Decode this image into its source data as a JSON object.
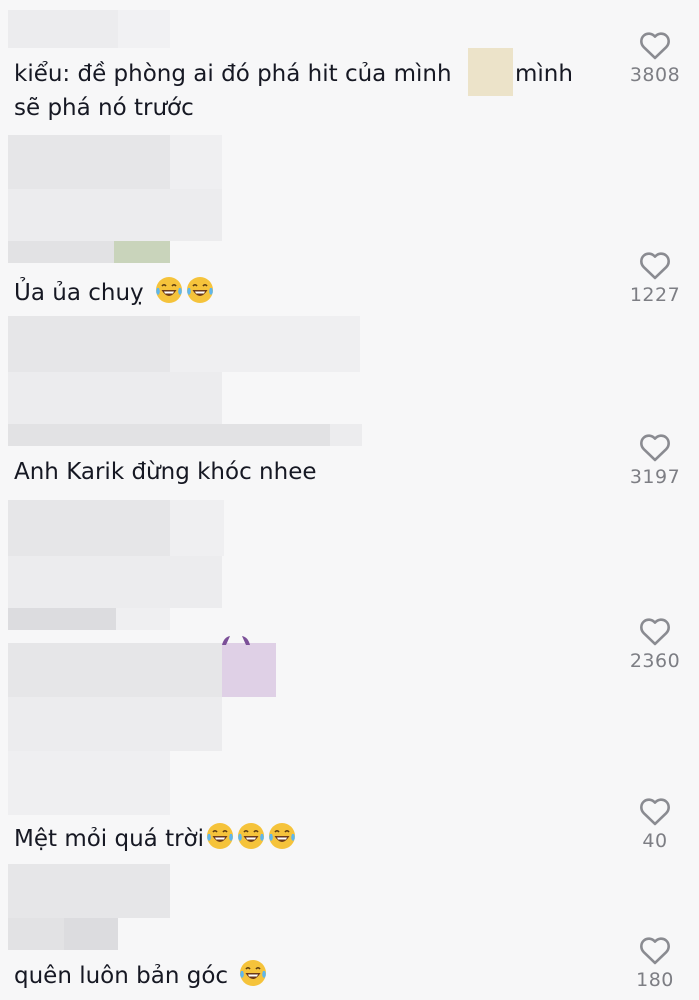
{
  "comments": [
    {
      "text_line1_a": "kiểu: đề phòng ai đó phá hit của mình",
      "text_line1_b": "mình",
      "text_line2": "sẽ phá nó trước",
      "likes": "3808",
      "emoji": []
    },
    {
      "text": "Ủa ủa chuỵ",
      "likes": "1227",
      "emoji": [
        "laughing-tears-emoji",
        "laughing-tears-emoji"
      ]
    },
    {
      "text": "Anh Karik đừng khóc nhee",
      "likes": "3197",
      "emoji": []
    },
    {
      "likes": "2360"
    },
    {
      "text": "Mệt mỏi quá trời",
      "likes": "40",
      "emoji": [
        "laughing-tears-emoji",
        "laughing-tears-emoji",
        "laughing-tears-emoji"
      ]
    },
    {
      "text": "quên luôn bản góc",
      "likes": "180",
      "emoji": [
        "laughing-tears-emoji"
      ]
    }
  ],
  "icons": {
    "like": "heart-outline-icon",
    "emoji": "laughing-tears-emoji"
  },
  "colors": {
    "background": "#f7f7f8",
    "text": "#161823",
    "like_count": "#7d7e84",
    "heart_stroke": "#8a8b91"
  }
}
